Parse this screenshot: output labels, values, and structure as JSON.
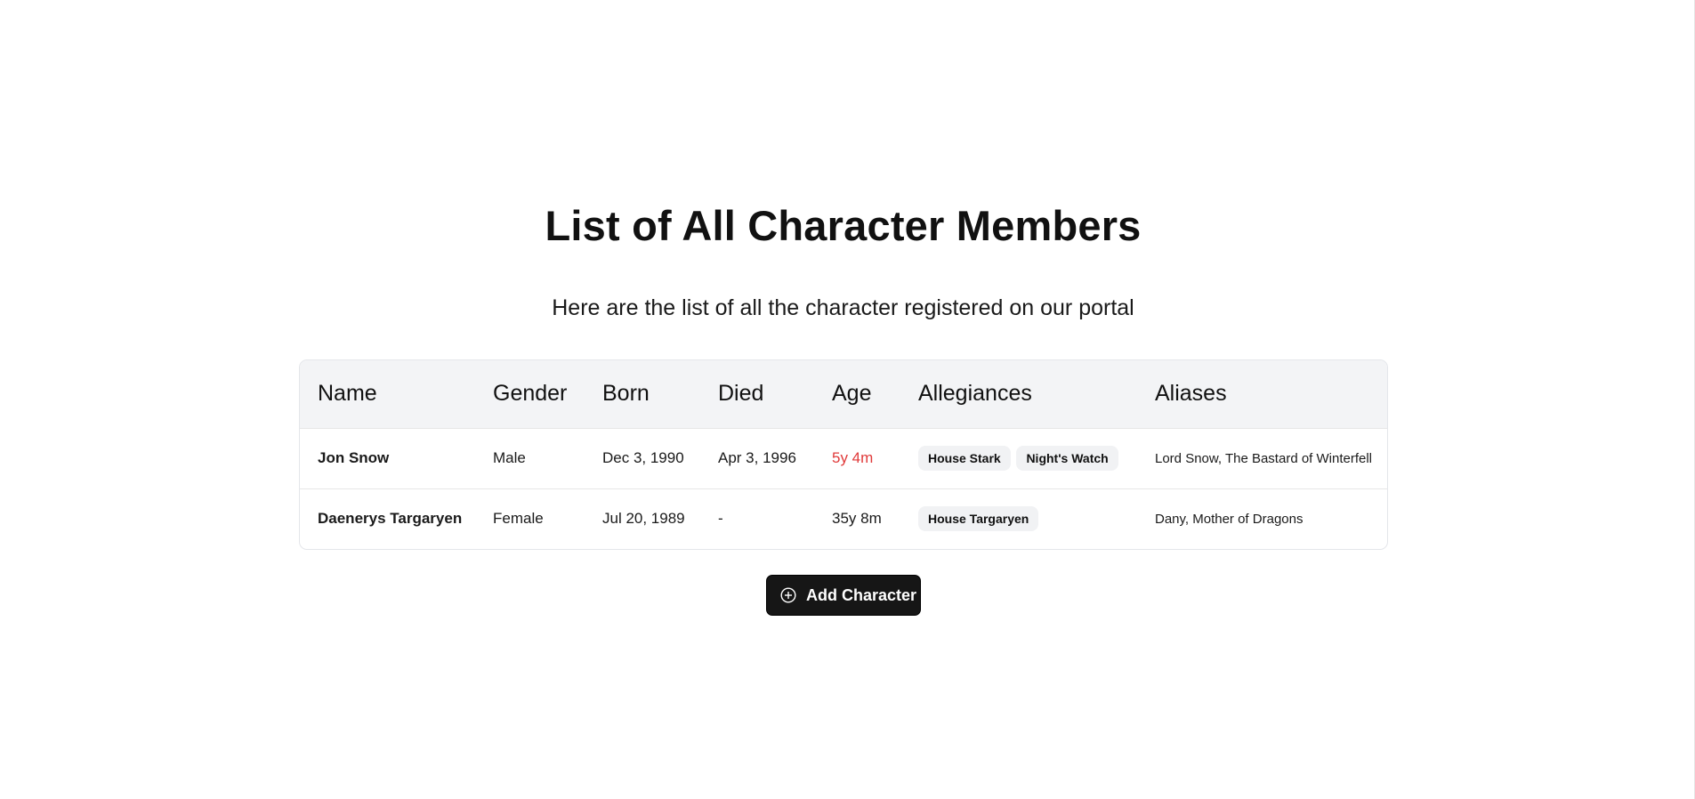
{
  "header": {
    "title": "List of All Character Members",
    "subtitle": "Here are the list of all the character registered on our portal"
  },
  "table": {
    "columns": [
      "Name",
      "Gender",
      "Born",
      "Died",
      "Age",
      "Allegiances",
      "Aliases"
    ],
    "rows": [
      {
        "name": "Jon Snow",
        "gender": "Male",
        "born": "Dec 3, 1990",
        "died": "Apr 3, 1996",
        "age": "5y 4m",
        "allegiances": [
          "House Stark",
          "Night's Watch"
        ],
        "aliases": "Lord Snow, The Bastard of Winterfell"
      },
      {
        "name": "Daenerys Targaryen",
        "gender": "Female",
        "born": "Jul 20, 1989",
        "died": "-",
        "age": "35y 8m",
        "allegiances": [
          "House Targaryen"
        ],
        "aliases": "Dany, Mother of Dragons"
      }
    ]
  },
  "actions": {
    "add_label": "Add Character",
    "add_icon": "plus-circle-icon"
  },
  "colors": {
    "deceased_age": "#e03a3a",
    "button_bg": "#161616",
    "header_bg": "#f3f4f6"
  }
}
